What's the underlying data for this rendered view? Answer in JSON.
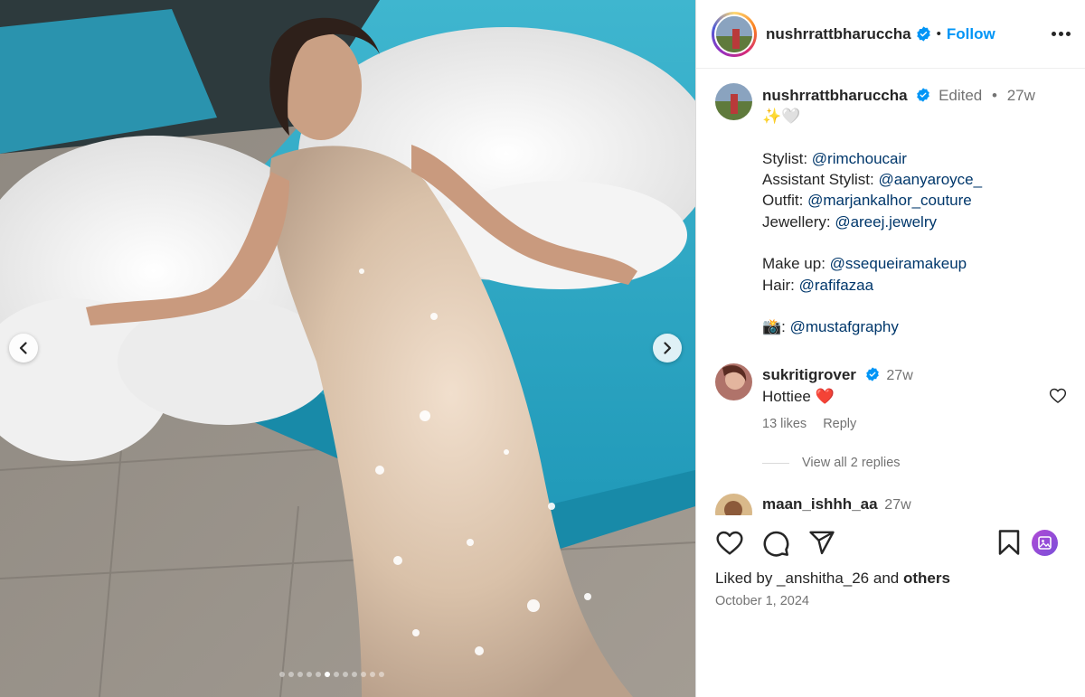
{
  "post": {
    "username": "nushrrattbharuccha",
    "follow_label": "Follow",
    "separator": "•",
    "carousel": {
      "total": 12,
      "active_index": 5
    }
  },
  "caption": {
    "username": "nushrrattbharuccha",
    "edited": "Edited",
    "dot": "•",
    "age": "27w",
    "emoji": "✨🤍",
    "lines": [
      {
        "prefix": "Stylist: ",
        "mention": "@rimchoucair"
      },
      {
        "prefix": "Assistant Stylist: ",
        "mention": "@aanyaroyce_"
      },
      {
        "prefix": "Outfit: ",
        "mention": "@marjankalhor_couture"
      },
      {
        "prefix": "Jewellery: ",
        "mention": "@areej.jewelry"
      },
      {
        "prefix": "Make up: ",
        "mention": "@ssequeiramakeup"
      },
      {
        "prefix": "Hair: ",
        "mention": "@rafifazaa"
      },
      {
        "prefix": "📸: ",
        "mention": "@mustafgraphy"
      }
    ]
  },
  "comments": [
    {
      "username": "sukritigrover",
      "age": "27w",
      "text": "Hottiee ❤️",
      "likes": "13 likes",
      "reply_label": "Reply",
      "view_replies": "View all 2 replies"
    },
    {
      "username": "maan_ishhh_aa",
      "age": "27w"
    }
  ],
  "footer": {
    "liked_prefix": "Liked by ",
    "liked_user": "_anshitha_26",
    "liked_and": " and ",
    "liked_others": "others",
    "date": "October 1, 2024"
  },
  "colors": {
    "link": "#0095f6",
    "mention": "#00376b",
    "verified": "#0095f6",
    "muted": "#737373"
  },
  "icons": [
    "chevron-left-icon",
    "chevron-right-icon",
    "verified-icon",
    "more-icon",
    "heart-icon",
    "comment-icon",
    "share-icon",
    "bookmark-icon",
    "sticker-icon"
  ]
}
